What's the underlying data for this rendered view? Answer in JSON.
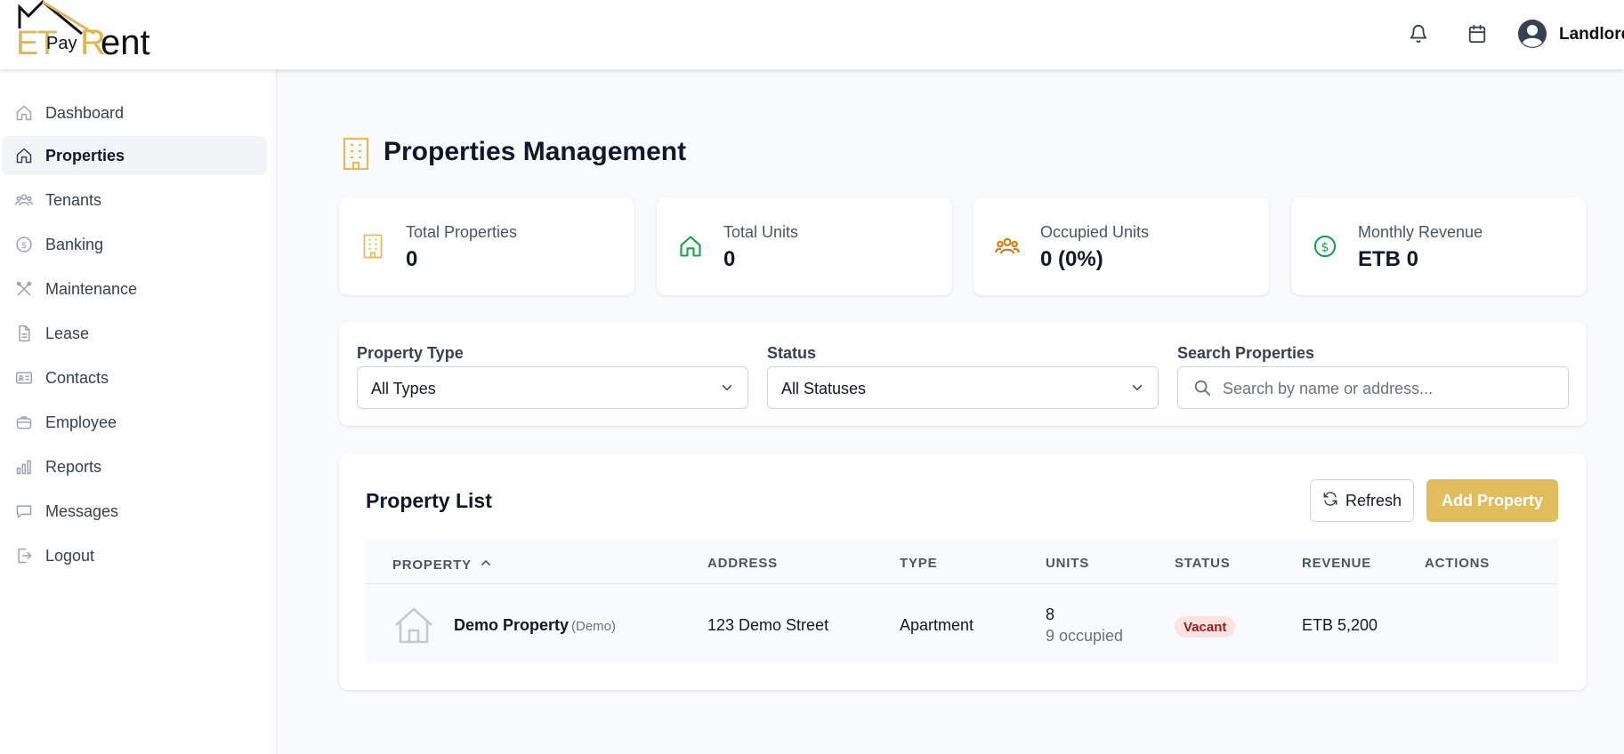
{
  "header": {
    "logo": {
      "part1": "ET",
      "part2": "Pay",
      "part3": "R",
      "part4": "ent"
    },
    "notification_icon": "bell-icon",
    "calendar_icon": "calendar-icon",
    "user": {
      "name": "Landlord",
      "avatar_icon": "user-circle-icon"
    }
  },
  "sidebar": {
    "items": [
      {
        "label": "Dashboard",
        "icon": "home-icon",
        "active": false
      },
      {
        "label": "Properties",
        "icon": "home-icon",
        "active": true
      },
      {
        "label": "Tenants",
        "icon": "users-icon",
        "active": false
      },
      {
        "label": "Banking",
        "icon": "dollar-circle-icon",
        "active": false
      },
      {
        "label": "Maintenance",
        "icon": "tools-icon",
        "active": false
      },
      {
        "label": "Lease",
        "icon": "document-icon",
        "active": false
      },
      {
        "label": "Contacts",
        "icon": "id-card-icon",
        "active": false
      },
      {
        "label": "Employee",
        "icon": "briefcase-icon",
        "active": false
      },
      {
        "label": "Reports",
        "icon": "bar-chart-icon",
        "active": false
      },
      {
        "label": "Messages",
        "icon": "chat-icon",
        "active": false
      },
      {
        "label": "Logout",
        "icon": "logout-icon",
        "active": false
      }
    ]
  },
  "main": {
    "title": "Properties Management",
    "stats": [
      {
        "label": "Total Properties",
        "value": "0",
        "icon": "building-icon",
        "color": "#e2bd5e"
      },
      {
        "label": "Total Units",
        "value": "0",
        "icon": "home-icon",
        "color": "#16a34a"
      },
      {
        "label": "Occupied Units",
        "value": "0 (0%)",
        "icon": "users-icon",
        "color": "#d97706"
      },
      {
        "label": "Monthly Revenue",
        "value": "ETB 0",
        "icon": "dollar-circle-icon",
        "color": "#16a34a"
      }
    ],
    "filters": {
      "property_type": {
        "label": "Property Type",
        "value": "All Types"
      },
      "status": {
        "label": "Status",
        "value": "All Statuses"
      },
      "search": {
        "label": "Search Properties",
        "placeholder": "Search by name or address..."
      }
    },
    "list": {
      "title": "Property List",
      "refresh_label": "Refresh",
      "add_label": "Add Property",
      "columns": [
        "PROPERTY",
        "ADDRESS",
        "TYPE",
        "UNITS",
        "STATUS",
        "REVENUE",
        "ACTIONS"
      ],
      "rows": [
        {
          "name": "Demo Property",
          "tag": "(Demo)",
          "address": "123 Demo Street",
          "type": "Apartment",
          "units": "8",
          "occupied": "9 occupied",
          "status": "Vacant",
          "revenue": "ETB 5,200"
        }
      ]
    }
  },
  "colors": {
    "accent": "#e2bd5e",
    "vacant_bg": "#fde2e2",
    "vacant_text": "#991b1b"
  }
}
